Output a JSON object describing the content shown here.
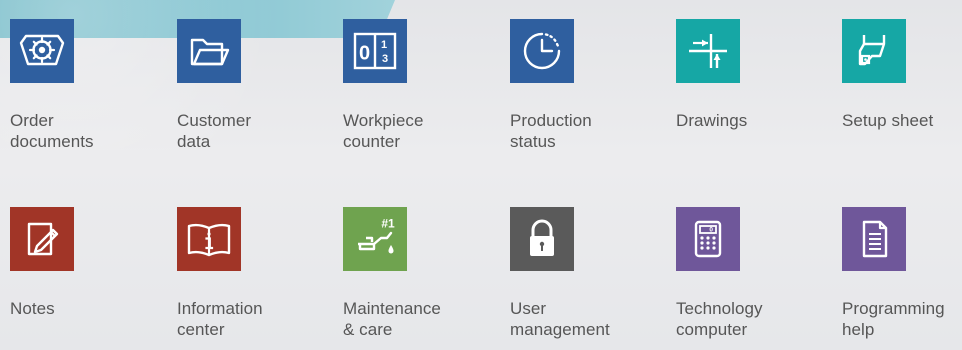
{
  "grid": {
    "row1": [
      {
        "id": "order-documents",
        "label": "Order\ndocuments",
        "icon": "gear-document-icon",
        "color": "#2f5f9f"
      },
      {
        "id": "customer-data",
        "label": "Customer\ndata",
        "icon": "folder-icon",
        "color": "#2f5f9f"
      },
      {
        "id": "workpiece-counter",
        "label": "Workpiece\ncounter",
        "icon": "counter-icon",
        "color": "#2f5f9f"
      },
      {
        "id": "production-status",
        "label": "Production\nstatus",
        "icon": "clock-icon",
        "color": "#2f5f9f"
      },
      {
        "id": "drawings",
        "label": "Drawings",
        "icon": "drawing-icon",
        "color": "#16a7a5"
      },
      {
        "id": "setup-sheet",
        "label": "Setup sheet",
        "icon": "setup-sheet-icon",
        "color": "#16a7a5"
      }
    ],
    "row2": [
      {
        "id": "notes",
        "label": "Notes",
        "icon": "notes-pencil-icon",
        "color": "#a13527"
      },
      {
        "id": "information-center",
        "label": "Information\ncenter",
        "icon": "book-info-icon",
        "color": "#a13527"
      },
      {
        "id": "maintenance-care",
        "label": "Maintenance\n& care",
        "icon": "oil-can-icon",
        "color": "#6fa34f"
      },
      {
        "id": "user-management",
        "label": "User\nmanagement",
        "icon": "lock-icon",
        "color": "#5a5a5a"
      },
      {
        "id": "technology-computer",
        "label": "Technology\ncomputer",
        "icon": "calculator-icon",
        "color": "#6f579a"
      },
      {
        "id": "programming-help",
        "label": "Programming\nhelp",
        "icon": "document-lines-icon",
        "color": "#6f579a"
      }
    ]
  },
  "icon_text": {
    "counter_left": "0",
    "counter_right": "1",
    "counter_bottom": "3",
    "maintenance_badge": "#1",
    "calculator_display": "0"
  }
}
